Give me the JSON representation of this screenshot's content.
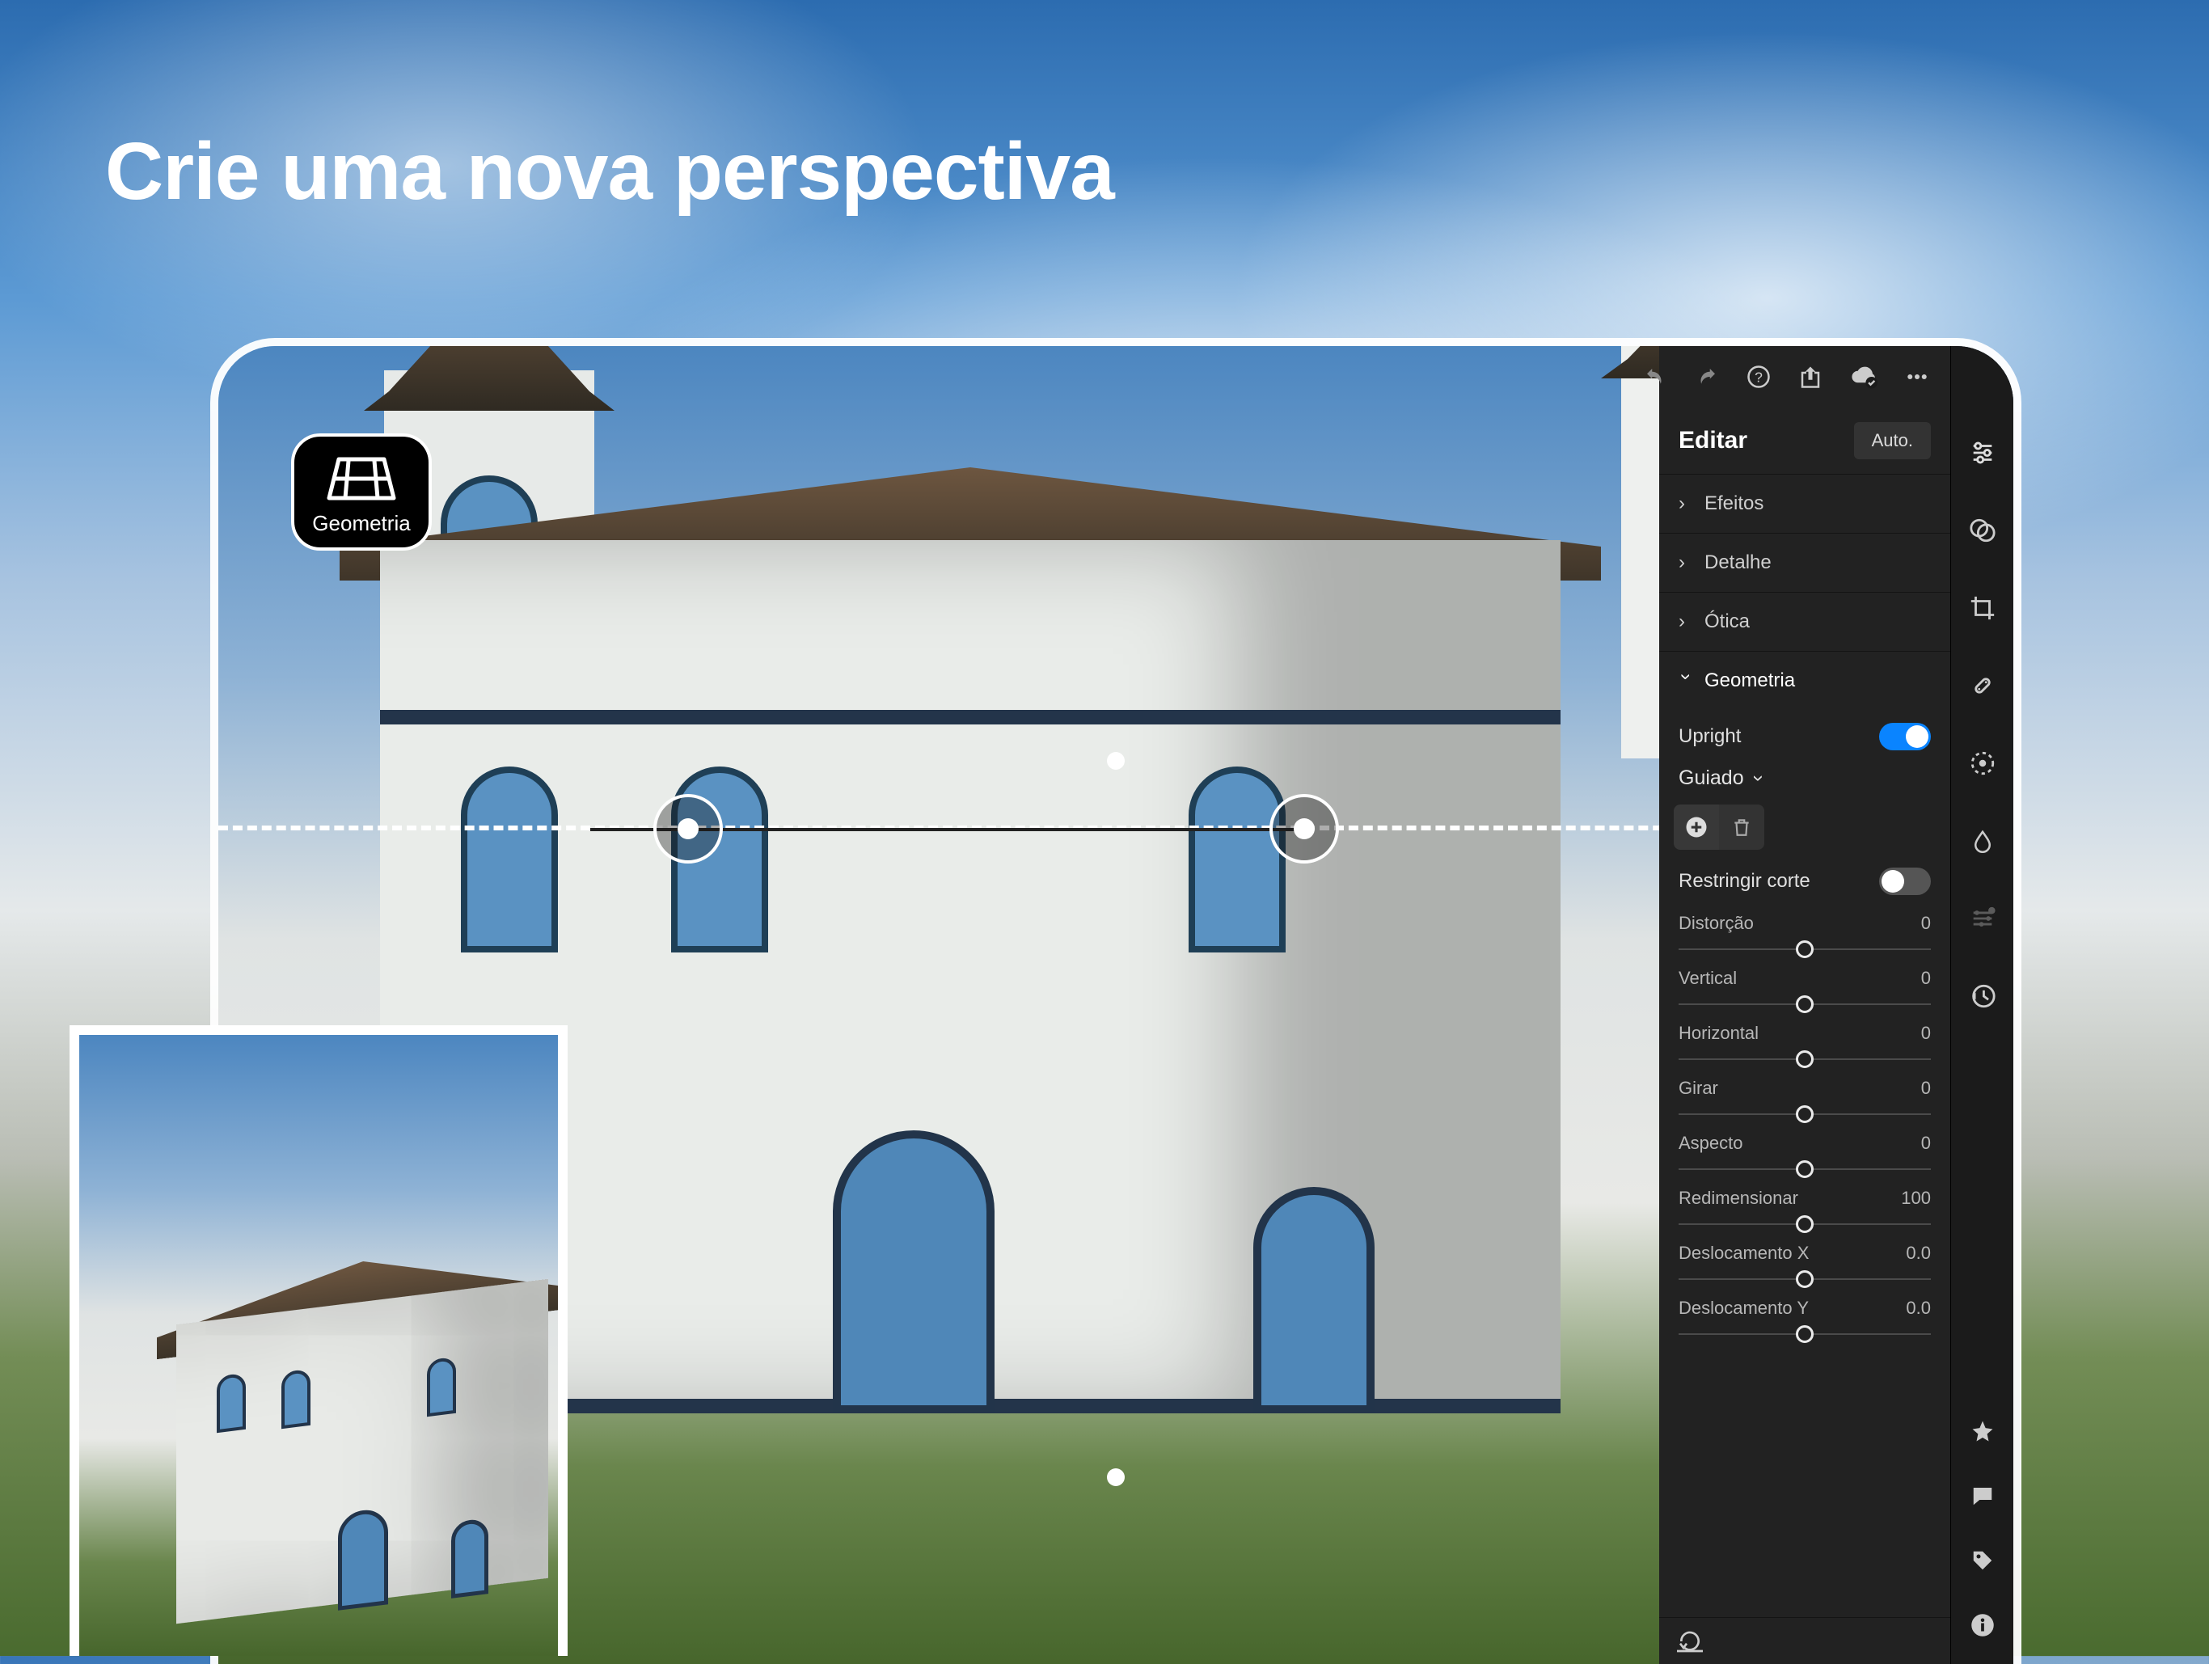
{
  "headline": "Crie uma nova perspectiva",
  "badge_label": "Geometria",
  "toolbar": {
    "undo": "undo",
    "redo": "redo",
    "help": "help",
    "share": "share",
    "cloud": "cloud-check",
    "more": "more"
  },
  "panel": {
    "title": "Editar",
    "auto_label": "Auto.",
    "sections": {
      "effects": "Efeitos",
      "detail": "Detalhe",
      "optics": "Ótica",
      "geometry": "Geometria"
    },
    "upright_label": "Upright",
    "upright_on": true,
    "guided_label": "Guiado",
    "constrain_label": "Restringir corte",
    "constrain_on": false,
    "sliders": [
      {
        "label": "Distorção",
        "value": "0",
        "pos": 50
      },
      {
        "label": "Vertical",
        "value": "0",
        "pos": 50
      },
      {
        "label": "Horizontal",
        "value": "0",
        "pos": 50
      },
      {
        "label": "Girar",
        "value": "0",
        "pos": 50
      },
      {
        "label": "Aspecto",
        "value": "0",
        "pos": 50
      },
      {
        "label": "Redimensionar",
        "value": "100",
        "pos": 50
      },
      {
        "label": "Deslocamento X",
        "value": "0.0",
        "pos": 50
      },
      {
        "label": "Deslocamento Y",
        "value": "0.0",
        "pos": 50
      }
    ]
  },
  "rail_icons": [
    "adjust",
    "profiles",
    "crop",
    "heal",
    "radial",
    "droplet",
    "eye-mix",
    "history"
  ],
  "rail_bottom_icons": [
    "star",
    "comment",
    "tag",
    "info"
  ]
}
